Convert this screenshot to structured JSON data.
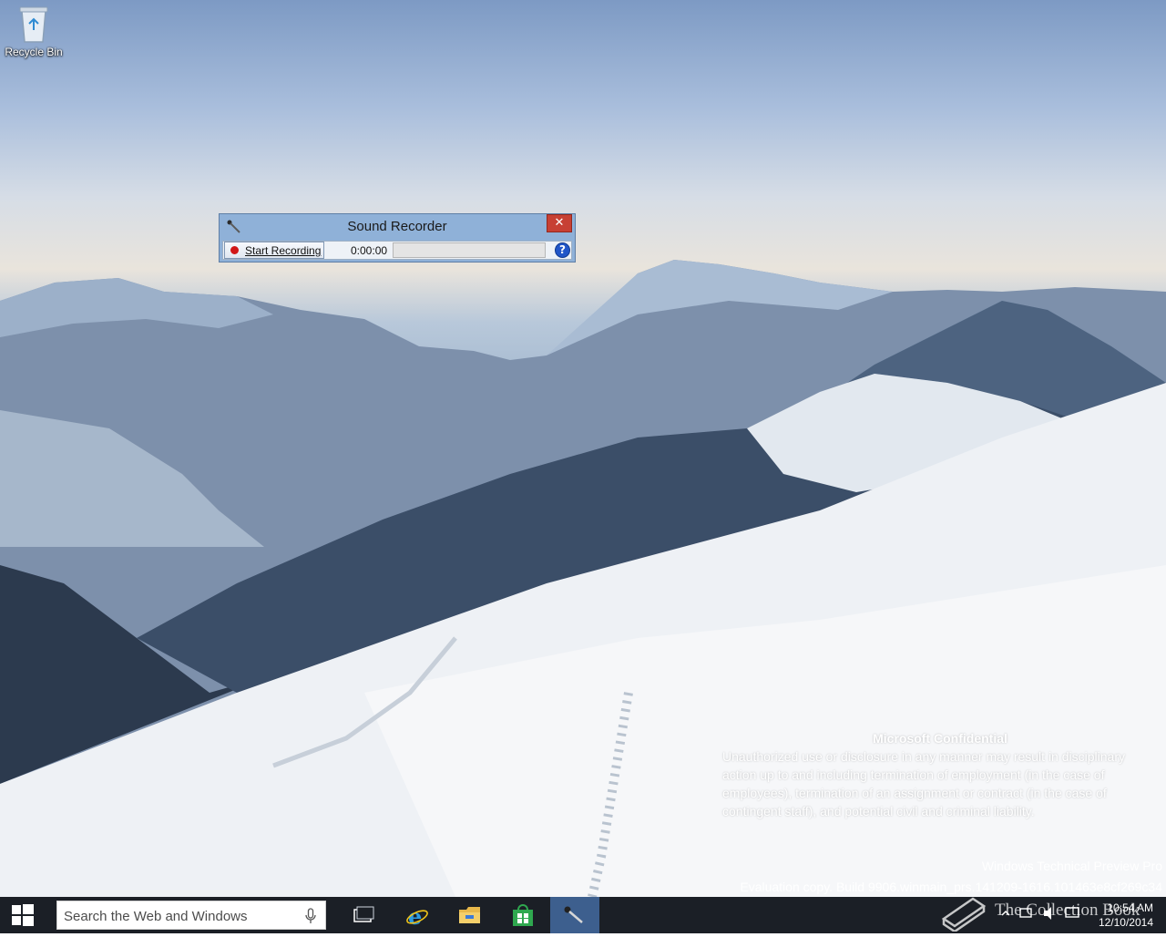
{
  "desktop": {
    "icons": [
      {
        "label": "Recycle Bin",
        "icon": "recycle-bin-icon"
      }
    ]
  },
  "window": {
    "title": "Sound Recorder",
    "close_label": "✕",
    "record_button_label": "Start Recording",
    "record_icon": "record-dot-icon",
    "elapsed_time": "0:00:00",
    "level_meter_fraction": 0,
    "help_label": "?"
  },
  "watermark": {
    "title": "Microsoft Confidential",
    "body": "Unauthorized use or disclosure in any manner may result in disciplinary action up to and including termination of employment (in the case of employees), termination of an assignment or contract (in the case of contingent staff), and potential civil and criminal liability.",
    "edition": "Windows Technical Preview Pro",
    "build": "Evaluation copy. Build 9906.winmain_prs.141209-1616.101463e8cf269c34"
  },
  "taskbar": {
    "search_placeholder": "Search the Web and Windows",
    "items": [
      {
        "name": "task-view",
        "icon": "task-view-icon"
      },
      {
        "name": "internet-explorer",
        "icon": "ie-icon"
      },
      {
        "name": "file-explorer",
        "icon": "folder-icon"
      },
      {
        "name": "store",
        "icon": "store-icon"
      },
      {
        "name": "sound-recorder",
        "icon": "microphone-icon",
        "active": true
      }
    ],
    "clock_time": "10:54 AM",
    "clock_date": "12/10/2014",
    "colors": {
      "taskbar": "#1b1f26",
      "active_item": "#3d5f8e",
      "accent": "#0078d7"
    }
  },
  "overlay": {
    "site_watermark": "The Collection Book"
  }
}
